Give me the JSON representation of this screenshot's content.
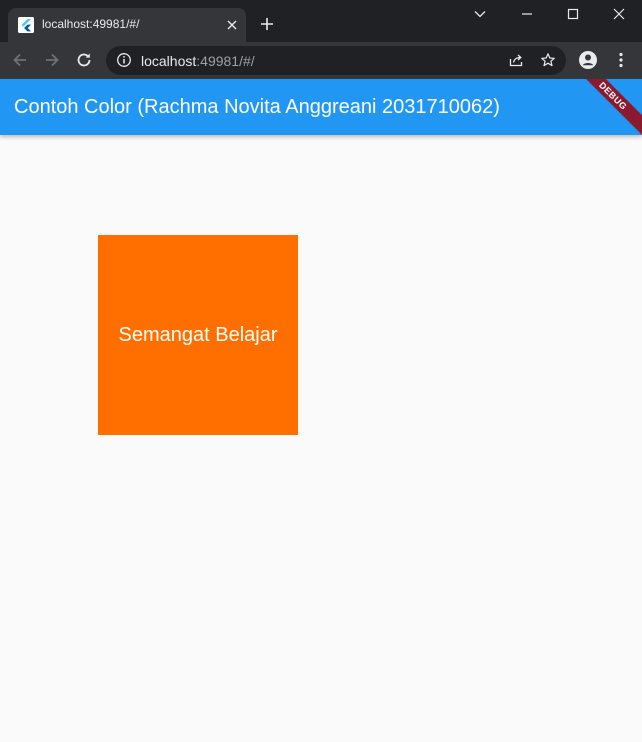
{
  "browser": {
    "tab_title": "localhost:49981/#/",
    "url_host": "localhost",
    "url_rest": ":49981/#/"
  },
  "app": {
    "title": "Contoh Color (Rachma Novita Anggreani 2031710062)",
    "debug_label": "DEBUG",
    "box_text": "Semangat Belajar",
    "colors": {
      "appbar": "#2196f3",
      "box": "#ff6f00",
      "background": "#fafafa"
    }
  }
}
